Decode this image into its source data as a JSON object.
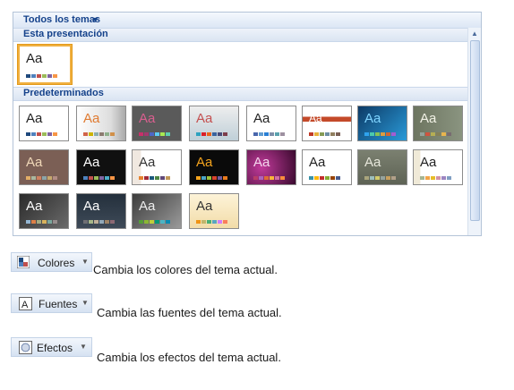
{
  "gallery": {
    "title": "Todos los temas",
    "groups": [
      {
        "label": "Esta presentación"
      },
      {
        "label": "Predeterminados"
      }
    ],
    "themes_label": "Aa"
  },
  "commands": [
    {
      "button_label": "Colores",
      "description": "Cambia los colores del tema actual.",
      "icon": "colors-icon"
    },
    {
      "button_label": "Fuentes",
      "description": "Cambia las fuentes  del tema actual.",
      "icon": "fonts-icon"
    },
    {
      "button_label": "Efectos",
      "description": "Cambia los efectos del tema actual.",
      "icon": "effects-icon"
    }
  ]
}
